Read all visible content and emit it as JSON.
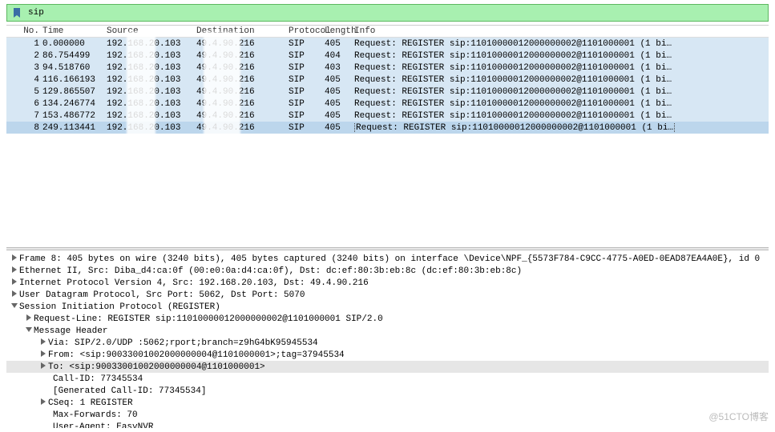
{
  "filter": {
    "value": "sip"
  },
  "columns": {
    "no": "No.",
    "time": "Time",
    "src": "Source",
    "dst": "Destination",
    "proto": "Protocol",
    "len": "Length",
    "info": "Info"
  },
  "packets": [
    {
      "no": 1,
      "time": "0.000000",
      "src": "192.168.20.103",
      "dst": "49.4.90.216",
      "proto": "SIP",
      "len": 405,
      "info": "Request: REGISTER sip:11010000012000000002@1101000001  (1 bi…",
      "sel": true
    },
    {
      "no": 2,
      "time": "86.754499",
      "src": "192.168.20.103",
      "dst": "49.4.90.216",
      "proto": "SIP",
      "len": 404,
      "info": "Request: REGISTER sip:11010000012000000002@1101000001  (1 bi…",
      "sel": true
    },
    {
      "no": 3,
      "time": "94.518760",
      "src": "192.168.20.103",
      "dst": "49.4.90.216",
      "proto": "SIP",
      "len": 403,
      "info": "Request: REGISTER sip:11010000012000000002@1101000001  (1 bi…",
      "sel": true
    },
    {
      "no": 4,
      "time": "116.166193",
      "src": "192.168.20.103",
      "dst": "49.4.90.216",
      "proto": "SIP",
      "len": 405,
      "info": "Request: REGISTER sip:11010000012000000002@1101000001  (1 bi…",
      "sel": true
    },
    {
      "no": 5,
      "time": "129.865507",
      "src": "192.168.20.103",
      "dst": "49.4.90.216",
      "proto": "SIP",
      "len": 405,
      "info": "Request: REGISTER sip:11010000012000000002@1101000001  (1 bi…",
      "sel": true
    },
    {
      "no": 6,
      "time": "134.246774",
      "src": "192.168.20.103",
      "dst": "49.4.90.216",
      "proto": "SIP",
      "len": 405,
      "info": "Request: REGISTER sip:11010000012000000002@1101000001  (1 bi…",
      "sel": true
    },
    {
      "no": 7,
      "time": "153.486772",
      "src": "192.168.20.103",
      "dst": "49.4.90.216",
      "proto": "SIP",
      "len": 405,
      "info": "Request: REGISTER sip:11010000012000000002@1101000001  (1 bi…",
      "sel": true
    },
    {
      "no": 8,
      "time": "249.113441",
      "src": "192.168.20.103",
      "dst": "49.4.90.216",
      "proto": "SIP",
      "len": 405,
      "info": "Request: REGISTER sip:11010000012000000002@1101000001  (1 bi…",
      "sel": true,
      "last": true
    }
  ],
  "details": {
    "frame": "Frame 8: 405 bytes on wire (3240 bits), 405 bytes captured (3240 bits) on interface \\Device\\NPF_{5573F784-C9CC-4775-A0ED-0EAD87EA4A0E}, id 0",
    "eth": "Ethernet II, Src: Diba_d4:ca:0f (00:e0:0a:d4:ca:0f), Dst: dc:ef:80:3b:eb:8c (dc:ef:80:3b:eb:8c)",
    "ip": "Internet Protocol Version 4, Src: 192.168.20.103, Dst: 49.4.90.216",
    "udp": "User Datagram Protocol, Src Port: 5062, Dst Port: 5070",
    "sip": "Session Initiation Protocol (REGISTER)",
    "reqline": "Request-Line: REGISTER sip:11010000012000000002@1101000001 SIP/2.0",
    "msghdr": "Message Header",
    "via": "Via: SIP/2.0/UDP :5062;rport;branch=z9hG4bK95945534",
    "from": "From: <sip:90033001002000000004@1101000001>;tag=37945534",
    "to": "To: <sip:90033001002000000004@1101000001>",
    "callid": "Call-ID: 77345534",
    "gencall": "[Generated Call-ID: 77345534]",
    "cseq": "CSeq: 1 REGISTER",
    "maxfwd": "Max-Forwards: 70",
    "ua": "User-Agent: EasyNVR"
  },
  "watermark": "@51CTO博客"
}
